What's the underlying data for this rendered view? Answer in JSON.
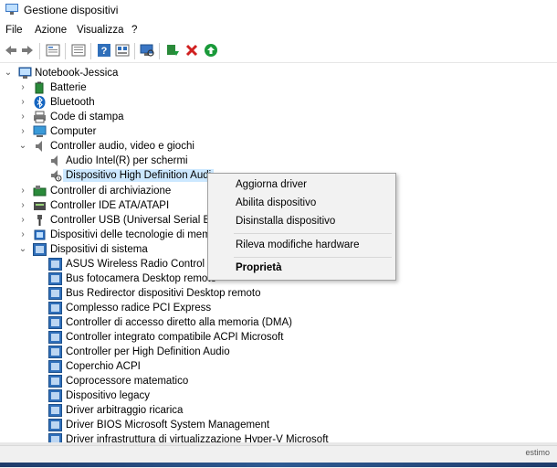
{
  "window": {
    "title": "Gestione dispositivi"
  },
  "menu": [
    "File",
    "Azione",
    "Visualizza",
    "?"
  ],
  "toolbar": {
    "buttons": [
      "back-arrow-icon",
      "forward-arrow-icon",
      "properties-icon",
      "view-icon",
      "help-icon",
      "show-hidden-icon",
      "scan-hardware-icon",
      "update-driver-icon",
      "uninstall-icon",
      "enable-device-icon"
    ]
  },
  "tree": {
    "root": "Notebook-Jessica",
    "items": [
      {
        "label": "Batterie",
        "level": 1,
        "expanded": false
      },
      {
        "label": "Bluetooth",
        "level": 1,
        "expanded": false
      },
      {
        "label": "Code di stampa",
        "level": 1,
        "expanded": false
      },
      {
        "label": "Computer",
        "level": 1,
        "expanded": false
      },
      {
        "label": "Controller audio, video e giochi",
        "level": 1,
        "expanded": true
      },
      {
        "label": "Audio Intel(R) per schermi",
        "level": 2
      },
      {
        "label": "Dispositivo High Definition Audi",
        "level": 2,
        "selected": true
      },
      {
        "label": "Controller di archiviazione",
        "level": 1,
        "expanded": false
      },
      {
        "label": "Controller IDE ATA/ATAPI",
        "level": 1,
        "expanded": false
      },
      {
        "label": "Controller USB (Universal Serial Bus)",
        "level": 1,
        "expanded": false
      },
      {
        "label": "Dispositivi delle tecnologie di memo",
        "level": 1,
        "expanded": false
      },
      {
        "label": "Dispositivi di sistema",
        "level": 1,
        "expanded": true
      },
      {
        "label": "ASUS Wireless Radio Control",
        "level": 2
      },
      {
        "label": "Bus fotocamera Desktop remoto",
        "level": 2
      },
      {
        "label": "Bus Redirector dispositivi Desktop remoto",
        "level": 2
      },
      {
        "label": "Complesso radice PCI Express",
        "level": 2
      },
      {
        "label": "Controller di accesso diretto alla memoria (DMA)",
        "level": 2
      },
      {
        "label": "Controller integrato compatibile ACPI Microsoft",
        "level": 2
      },
      {
        "label": "Controller per High Definition Audio",
        "level": 2
      },
      {
        "label": "Coperchio ACPI",
        "level": 2
      },
      {
        "label": "Coprocessore matematico",
        "level": 2
      },
      {
        "label": "Dispositivo legacy",
        "level": 2
      },
      {
        "label": "Driver arbitraggio ricarica",
        "level": 2
      },
      {
        "label": "Driver BIOS Microsoft System Management",
        "level": 2
      },
      {
        "label": "Driver infrastruttura di virtualizzazione Hyper-V Microsoft",
        "level": 2
      }
    ]
  },
  "context_menu": {
    "items": [
      "Aggiorna driver",
      "Abilita dispositivo",
      "Disinstalla dispositivo",
      "Rileva modifiche hardware",
      "Proprietà"
    ]
  },
  "status": {
    "tail": "estimo"
  },
  "colors": {
    "selection": "#cce8ff",
    "menu_bg": "#f2f2f2",
    "accent_red": "#d02020",
    "accent_green": "#1a9a3a"
  }
}
